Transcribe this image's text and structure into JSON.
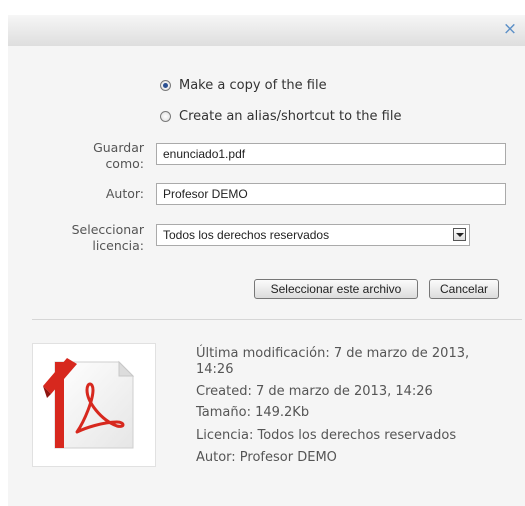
{
  "dialog": {
    "close_glyph": "×"
  },
  "options": {
    "copy_label": "Make a copy of the file",
    "alias_label": "Create an alias/shortcut to the file",
    "selected": "copy"
  },
  "form": {
    "save_as_label_1": "Guardar",
    "save_as_label_2": "como:",
    "save_as_value": "enunciado1.pdf",
    "author_label": "Autor:",
    "author_value": "Profesor DEMO",
    "license_label_1": "Seleccionar",
    "license_label_2": "licencia:",
    "license_value": "Todos los derechos reservados"
  },
  "buttons": {
    "select_label": "Seleccionar este archivo",
    "cancel_label": "Cancelar"
  },
  "file_info": {
    "last_modified_1": "Última modificación: 7 de marzo de 2013,",
    "last_modified_2": "14:26",
    "created": "Created: 7 de marzo de 2013, 14:26",
    "size": "Tamaño: 149.2Kb",
    "license": "Licencia: Todos los derechos reservados",
    "author": "Autor: Profesor DEMO"
  },
  "icons": {
    "file": "pdf-file-icon",
    "close": "close-icon",
    "dropdown": "chevron-down-icon"
  },
  "colors": {
    "accent": "#5b8fc7",
    "pdf_red": "#d7281e"
  }
}
